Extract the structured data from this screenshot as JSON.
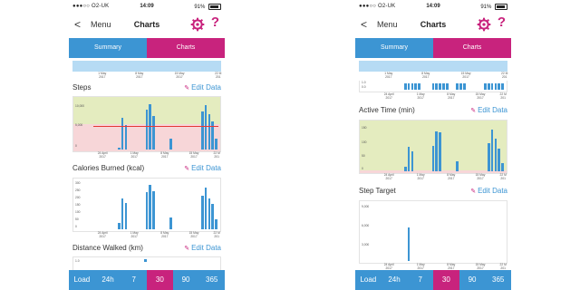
{
  "colors": {
    "accent_blue": "#3c95d3",
    "accent_pink": "#c8237d",
    "steps_band_top": "#e4ecbf",
    "steps_band_bottom": "#f7d6d8",
    "target_line": "#e53935"
  },
  "status_bar": {
    "carrier": "●●●○○ O2-UK",
    "time": "14:09",
    "battery": "91%"
  },
  "nav": {
    "back_icon": "chevron-left-icon",
    "menu": "Menu",
    "title": "Charts",
    "settings_icon": "gear-icon",
    "help": "?"
  },
  "tabs": [
    {
      "label": "Summary",
      "active": false
    },
    {
      "label": "Charts",
      "active": true
    }
  ],
  "bottom_bar": {
    "items": [
      "Load",
      "24h",
      "7",
      "30",
      "90",
      "365"
    ],
    "active": "30"
  },
  "edit_label": "Edit Data",
  "timeline_labels": [
    {
      "text": "1 May\n2017",
      "pos": 0.2
    },
    {
      "text": "8 May\n2017",
      "pos": 0.45
    },
    {
      "text": "15 May\n2017",
      "pos": 0.72
    },
    {
      "text": "22 M\n201",
      "pos": 0.98
    }
  ],
  "chart_x_labels": [
    {
      "text": "24 April\n2017",
      "pos": 0.08
    },
    {
      "text": "1 May\n2017",
      "pos": 0.33
    },
    {
      "text": "8 May\n2017",
      "pos": 0.57
    },
    {
      "text": "15 May\n2017",
      "pos": 0.8
    },
    {
      "text": "22 M\n201",
      "pos": 0.98
    }
  ],
  "left_screen": {
    "steps": {
      "title": "Steps",
      "y_ticks": [
        "10,000",
        "5,000",
        "0"
      ],
      "chart_data": {
        "type": "bar",
        "ylim": [
          0,
          13000
        ],
        "target": 6000,
        "values": [
          0,
          0,
          0,
          0,
          0,
          0,
          0,
          500,
          8500,
          6400,
          0,
          0,
          0,
          0,
          0,
          10600,
          12000,
          8800,
          0,
          0,
          0,
          0,
          3000,
          0,
          0,
          0,
          0,
          0,
          0,
          0,
          0,
          10200,
          11800,
          9300,
          7400,
          2800
        ]
      }
    },
    "calories": {
      "title": "Calories Burned (kcal)",
      "y_ticks": [
        "300",
        "250",
        "200",
        "150",
        "100",
        "50",
        "0"
      ],
      "chart_data": {
        "type": "bar",
        "ylim": [
          0,
          370
        ],
        "values": [
          0,
          0,
          0,
          0,
          0,
          0,
          0,
          50,
          240,
          210,
          0,
          0,
          0,
          0,
          0,
          295,
          350,
          300,
          0,
          0,
          0,
          0,
          90,
          0,
          0,
          0,
          0,
          0,
          0,
          0,
          0,
          260,
          330,
          240,
          200,
          80
        ]
      }
    },
    "distance": {
      "title": "Distance Walked (km)",
      "y_tick": "1.0"
    }
  },
  "right_screen": {
    "top_mini_chart": {
      "y_ticks": [
        "1.0",
        "0.5",
        "0.0"
      ],
      "values": [
        0,
        0,
        0,
        0,
        0,
        0,
        0,
        1,
        1,
        1,
        1,
        1,
        0,
        0,
        0,
        1,
        1,
        1,
        1,
        1,
        0,
        0,
        1,
        1,
        1,
        0,
        0,
        0,
        0,
        0,
        1,
        1,
        1,
        1,
        1,
        1
      ]
    },
    "active_time": {
      "title": "Active Time (min)",
      "y_ticks": [
        "150",
        "100",
        "50",
        "0"
      ],
      "chart_data": {
        "type": "bar",
        "ylim": [
          0,
          165
        ],
        "values": [
          0,
          0,
          0,
          0,
          0,
          0,
          0,
          15,
          85,
          70,
          0,
          0,
          0,
          0,
          0,
          90,
          140,
          135,
          0,
          0,
          0,
          0,
          35,
          0,
          0,
          0,
          0,
          0,
          0,
          0,
          0,
          100,
          145,
          115,
          80,
          30
        ]
      }
    },
    "step_target": {
      "title": "Step Target",
      "y_ticks": [
        "9,000",
        "6,000",
        "3,000"
      ],
      "chart_data": {
        "type": "bar",
        "ylim": [
          0,
          10000
        ],
        "values": [
          0,
          0,
          0,
          0,
          0,
          0,
          0,
          0,
          6000,
          0,
          0,
          0,
          0,
          0,
          0,
          0,
          0,
          0,
          0,
          0,
          0,
          0,
          0,
          0,
          0,
          0,
          0,
          0,
          0,
          0,
          0,
          0,
          0,
          0,
          0,
          0
        ]
      }
    }
  }
}
